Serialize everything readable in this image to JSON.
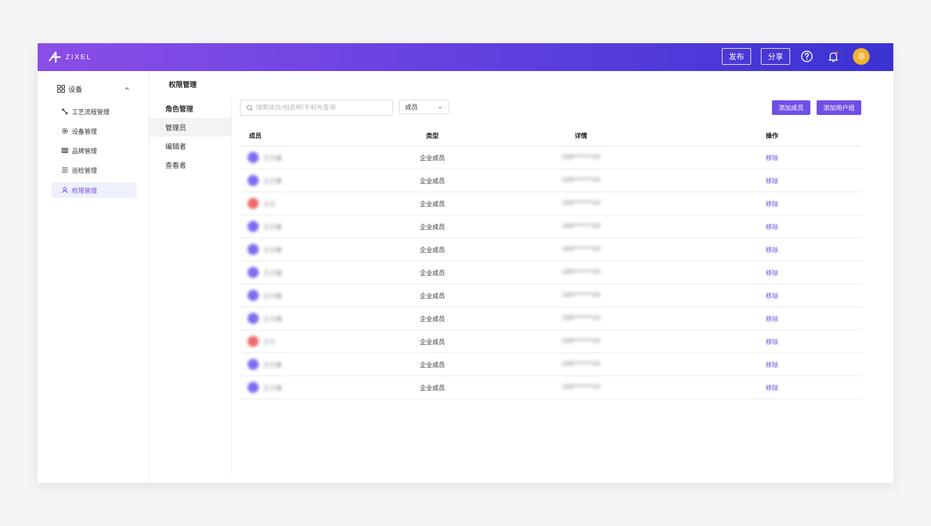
{
  "header": {
    "logo_text": "ZIXEL",
    "publish_label": "发布",
    "share_label": "分享",
    "avatar_text": "非"
  },
  "sidebar": {
    "group_label": "设备",
    "items": [
      {
        "label": "工艺流程管理",
        "icon": "process-icon"
      },
      {
        "label": "设备管理",
        "icon": "gear-icon"
      },
      {
        "label": "品牌管理",
        "icon": "brand-icon"
      },
      {
        "label": "巡检管理",
        "icon": "list-icon"
      },
      {
        "label": "权限管理",
        "icon": "user-icon",
        "active": true
      }
    ]
  },
  "page": {
    "title": "权限管理"
  },
  "roles": {
    "heading": "角色管理",
    "items": [
      "管理员",
      "编辑者",
      "查看者"
    ],
    "active_index": 0
  },
  "toolbar": {
    "search_placeholder": "搜索成员/组名称/手机号查询",
    "filter_value": "成员",
    "add_member_label": "添加成员",
    "add_group_label": "添加用户组"
  },
  "table": {
    "columns": [
      "成员",
      "类型",
      "详情",
      "操作"
    ],
    "rows": [
      {
        "name": "王大锤",
        "type": "企业成员",
        "detail": "189******20",
        "action": "移除",
        "avatar_color": "#7b6cf0"
      },
      {
        "name": "王大锤",
        "type": "企业成员",
        "detail": "189******20",
        "action": "移除",
        "avatar_color": "#7b6cf0"
      },
      {
        "name": "王大",
        "type": "企业成员",
        "detail": "189******20",
        "action": "移除",
        "avatar_color": "#f06a6a"
      },
      {
        "name": "王大锤",
        "type": "企业成员",
        "detail": "189******20",
        "action": "移除",
        "avatar_color": "#7b6cf0"
      },
      {
        "name": "王大锤",
        "type": "企业成员",
        "detail": "189******20",
        "action": "移除",
        "avatar_color": "#7b6cf0"
      },
      {
        "name": "王大锤",
        "type": "企业成员",
        "detail": "189******20",
        "action": "移除",
        "avatar_color": "#7b6cf0"
      },
      {
        "name": "王大锤",
        "type": "企业成员",
        "detail": "189******20",
        "action": "移除",
        "avatar_color": "#7b6cf0"
      },
      {
        "name": "王大锤",
        "type": "企业成员",
        "detail": "189******20",
        "action": "移除",
        "avatar_color": "#7b6cf0"
      },
      {
        "name": "王大",
        "type": "企业成员",
        "detail": "189******20",
        "action": "移除",
        "avatar_color": "#f06a6a"
      },
      {
        "name": "王大锤",
        "type": "企业成员",
        "detail": "189******20",
        "action": "移除",
        "avatar_color": "#7b6cf0"
      },
      {
        "name": "王大锤",
        "type": "企业成员",
        "detail": "189******20",
        "action": "移除",
        "avatar_color": "#7b6cf0"
      }
    ]
  },
  "colors": {
    "accent": "#6f4fe6",
    "header_gradient_start": "#8a4ee6",
    "header_gradient_end": "#3a33d2"
  }
}
